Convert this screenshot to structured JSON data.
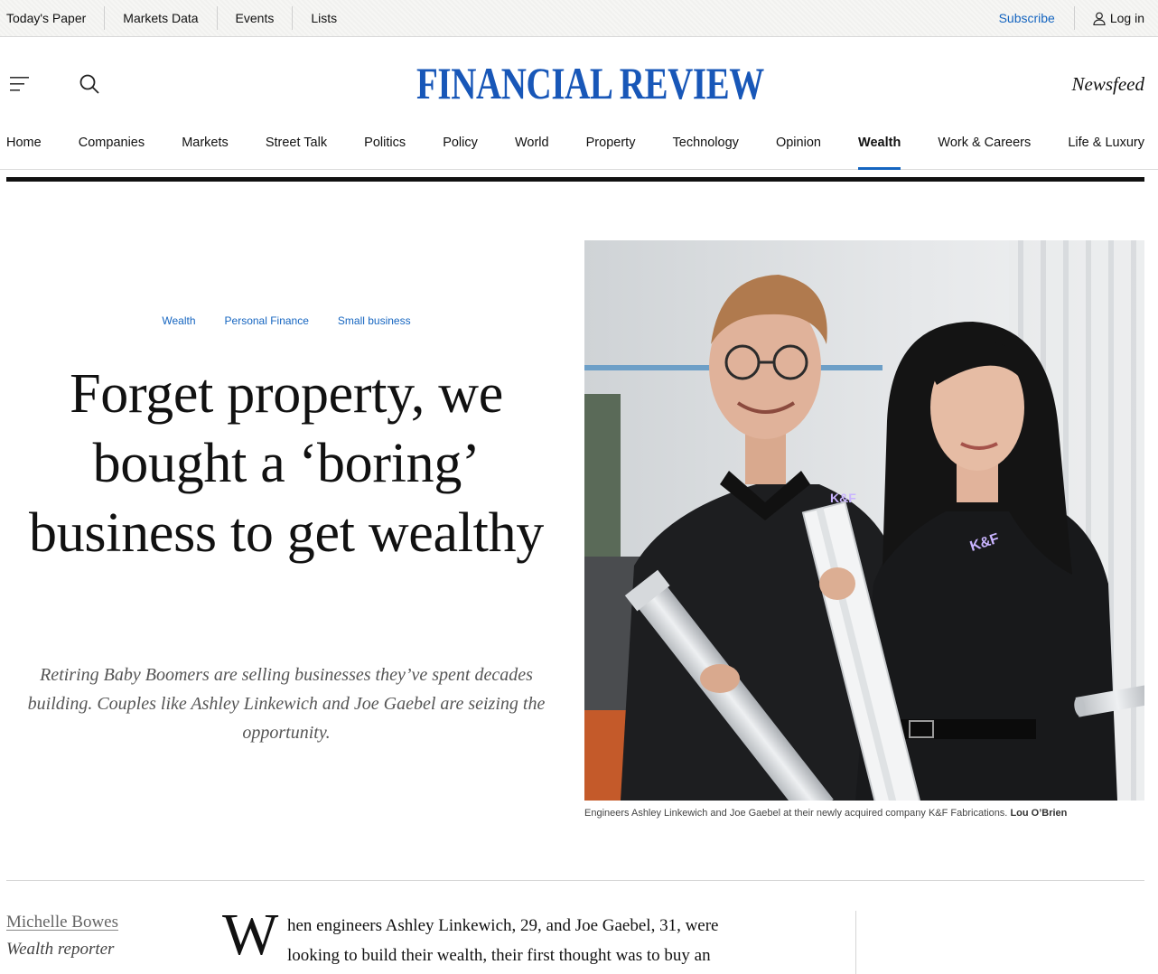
{
  "utility": {
    "links": [
      "Today's Paper",
      "Markets Data",
      "Events",
      "Lists"
    ],
    "subscribe": "Subscribe",
    "login": "Log in"
  },
  "masthead": {
    "logo": "FINANCIAL REVIEW",
    "newsfeed": "Newsfeed",
    "brand_color": "#1857b8"
  },
  "nav": {
    "items": [
      "Home",
      "Companies",
      "Markets",
      "Street Talk",
      "Politics",
      "Policy",
      "World",
      "Property",
      "Technology",
      "Opinion",
      "Wealth",
      "Work & Careers",
      "Life & Luxury"
    ],
    "active": "Wealth",
    "accent_color": "#1565c0"
  },
  "article": {
    "tags": [
      "Wealth",
      "Personal Finance",
      "Small business"
    ],
    "headline": "Forget property, we bought a ‘boring’ business to get wealthy",
    "standfirst": "Retiring Baby Boomers are selling businesses they’ve spent decades building. Couples like Ashley Linkewich and Joe Gaebel are seizing the opportunity.",
    "image_alt": "Engineers Ashley Linkewich and Joe Gaebel holding aluminium tubing",
    "caption": "Engineers Ashley Linkewich and Joe Gaebel at their newly acquired company K&F Fabrications.",
    "credit": "Lou O’Brien",
    "shirt_logo": "K&F",
    "author": "Michelle Bowes",
    "author_role": "Wealth reporter",
    "dropcap": "W",
    "body_lines": [
      "hen engineers Ashley Linkewich, 29, and Joe Gaebel, 31, were",
      "looking to build their wealth, their first thought was to buy an"
    ]
  }
}
